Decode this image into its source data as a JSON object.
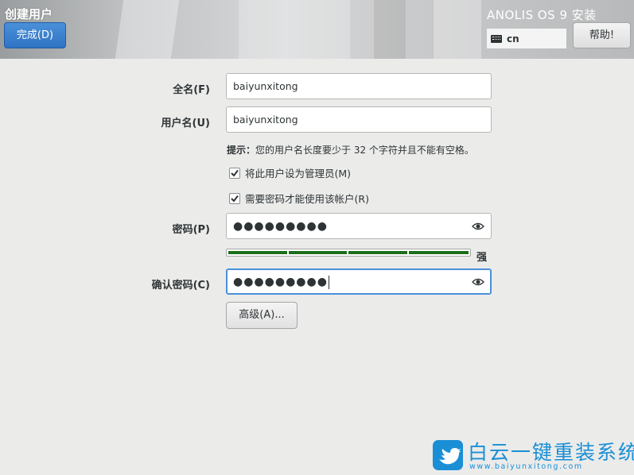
{
  "header": {
    "spoke_title": "创建用户",
    "done_label": "完成(D)",
    "install_title": "ANOLIS OS 9 安装",
    "keyboard_layout": "cn",
    "help_label": "帮助!"
  },
  "form": {
    "fullname": {
      "label": "全名(F)",
      "value": "baiyunxitong"
    },
    "username": {
      "label": "用户名(U)",
      "value": "baiyunxitong"
    },
    "hint": {
      "prefix": "提示：",
      "text": "您的用户名长度要少于 32 个字符并且不能有空格。"
    },
    "admin_checkbox": {
      "label": "将此用户设为管理员(M)",
      "checked": true
    },
    "require_password_checkbox": {
      "label": "需要密码才能使用该帐户(R)",
      "checked": true
    },
    "password": {
      "label": "密码(P)",
      "masked_value": "●●●●●●●●●"
    },
    "strength": {
      "level": 1.0,
      "segments": 4,
      "label": "强",
      "color": "#1b6f1b"
    },
    "confirm_password": {
      "label": "确认密码(C)",
      "masked_value": "●●●●●●●●●"
    },
    "advanced_label": "高级(A)..."
  },
  "watermark": {
    "brand": "白云一键重装系统",
    "url": "www.baiyunxitong.com"
  },
  "colors": {
    "accent": "#4a90d9",
    "background": "#ebebea",
    "watermark": "#1a8fd6"
  }
}
